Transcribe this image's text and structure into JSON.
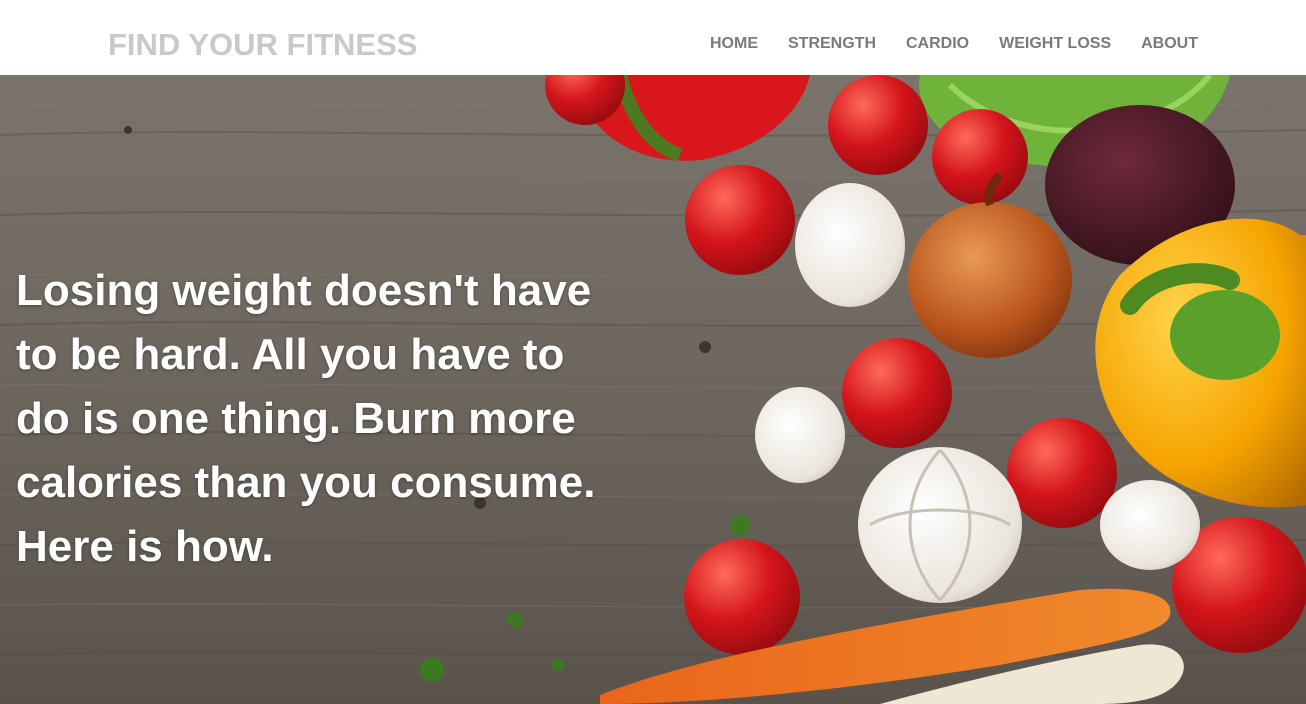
{
  "brand": {
    "title": "FIND YOUR FITNESS"
  },
  "nav": {
    "items": [
      {
        "label": "HOME"
      },
      {
        "label": "STRENGTH"
      },
      {
        "label": "CARDIO"
      },
      {
        "label": "WEIGHT LOSS"
      },
      {
        "label": "ABOUT"
      }
    ]
  },
  "hero": {
    "headline": "Losing weight doesn't have to be hard. All you have to do is one thing. Burn more calories than you consume. Here is how.",
    "image_semantic": "vegetables-on-wooden-table"
  },
  "colors": {
    "brand_text": "#c9c9c9",
    "nav_text": "#7a7a7a",
    "hero_text": "#ffffff"
  }
}
